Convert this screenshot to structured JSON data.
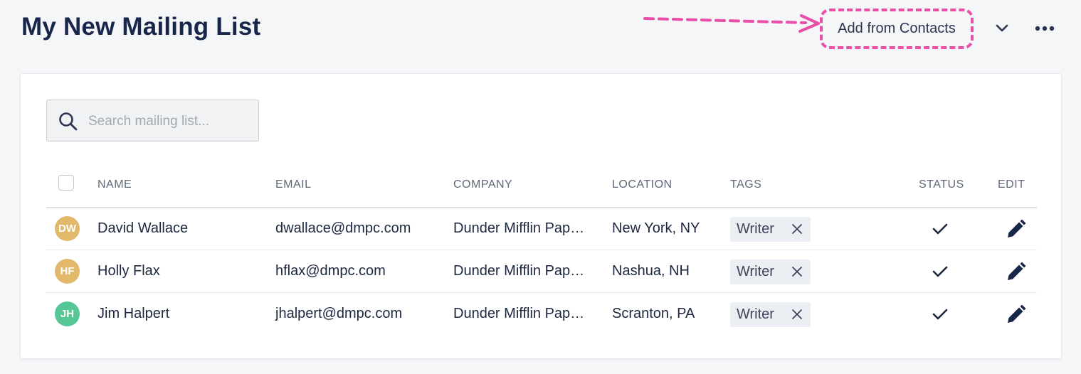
{
  "header": {
    "title": "My New Mailing List",
    "add_button_label": "Add from Contacts"
  },
  "search": {
    "placeholder": "Search mailing list..."
  },
  "table": {
    "columns": [
      "NAME",
      "EMAIL",
      "COMPANY",
      "LOCATION",
      "TAGS",
      "STATUS",
      "EDIT"
    ],
    "rows": [
      {
        "initials": "DW",
        "avatar_color": "#e2b86b",
        "name": "David Wallace",
        "email": "dwallace@dmpc.com",
        "company": "Dunder Mifflin Pap…",
        "location": "New York, NY",
        "tag": "Writer"
      },
      {
        "initials": "HF",
        "avatar_color": "#e2b86b",
        "name": "Holly Flax",
        "email": "hflax@dmpc.com",
        "company": "Dunder Mifflin Pap…",
        "location": "Nashua, NH",
        "tag": "Writer"
      },
      {
        "initials": "JH",
        "avatar_color": "#55c796",
        "name": "Jim Halpert",
        "email": "jhalpert@dmpc.com",
        "company": "Dunder Mifflin Pap…",
        "location": "Scranton, PA",
        "tag": "Writer"
      }
    ]
  },
  "icons": {
    "search": "search-icon",
    "chevron": "chevron-down-icon",
    "more": "more-horizontal-icon",
    "tag_remove": "close-icon",
    "status": "check-icon",
    "edit": "pencil-icon"
  },
  "colors": {
    "annotation": "#e94ea9",
    "title": "#17264a"
  }
}
